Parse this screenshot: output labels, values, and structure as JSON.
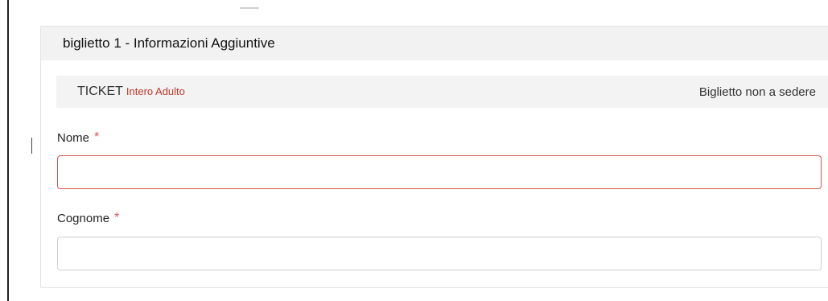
{
  "panel": {
    "header_title": "biglietto 1 - Informazioni Aggiuntive",
    "ticket": {
      "type": "TICKET",
      "description": "Intero Adulto",
      "seat_info": "Biglietto non a sedere"
    }
  },
  "form": {
    "fields": [
      {
        "label": "Nome",
        "required_mark": "*",
        "value": "",
        "placeholder": ""
      },
      {
        "label": "Cognome",
        "required_mark": "*",
        "value": "",
        "placeholder": ""
      }
    ]
  },
  "colors": {
    "required": "#d9534f",
    "ticket_desc": "#c0392b",
    "header_bg": "#f2f2f2"
  }
}
